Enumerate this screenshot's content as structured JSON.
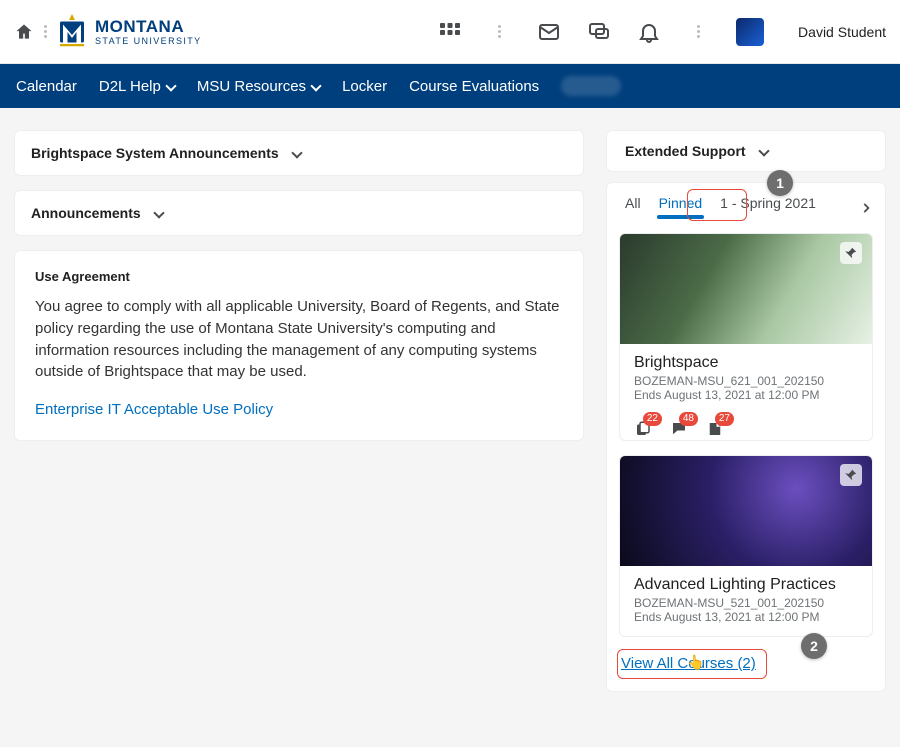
{
  "brand": {
    "line1": "MONTANA",
    "line2": "STATE UNIVERSITY"
  },
  "user": {
    "name": "David Student"
  },
  "nav": {
    "calendar": "Calendar",
    "d2l": "D2L Help",
    "msu": "MSU Resources",
    "locker": "Locker",
    "evals": "Course Evaluations"
  },
  "widgets": {
    "sys_ann": "Brightspace System Announcements",
    "ann": "Announcements",
    "ext": "Extended Support",
    "use_title": "Use Agreement",
    "use_body": "You agree to comply with all applicable University, Board of Regents, and State policy regarding the use of Montana State University's computing and information resources including the management of any computing systems outside of Brightspace that may be used.",
    "use_link": "Enterprise IT Acceptable Use Policy"
  },
  "tabs": {
    "all": "All",
    "pinned": "Pinned",
    "term": "1 - Spring 2021"
  },
  "markers": {
    "one": "1",
    "two": "2"
  },
  "courses": [
    {
      "title": "Brightspace",
      "code": "BOZEMAN-MSU_621_001_202150",
      "ends": "Ends August 13, 2021 at 12:00 PM",
      "badges": {
        "updates": "22",
        "discussions": "48",
        "assignments": "27"
      }
    },
    {
      "title": "Advanced Lighting Practices",
      "code": "BOZEMAN-MSU_521_001_202150",
      "ends": "Ends August 13, 2021 at 12:00 PM"
    }
  ],
  "view_all": "View All Courses (2)"
}
